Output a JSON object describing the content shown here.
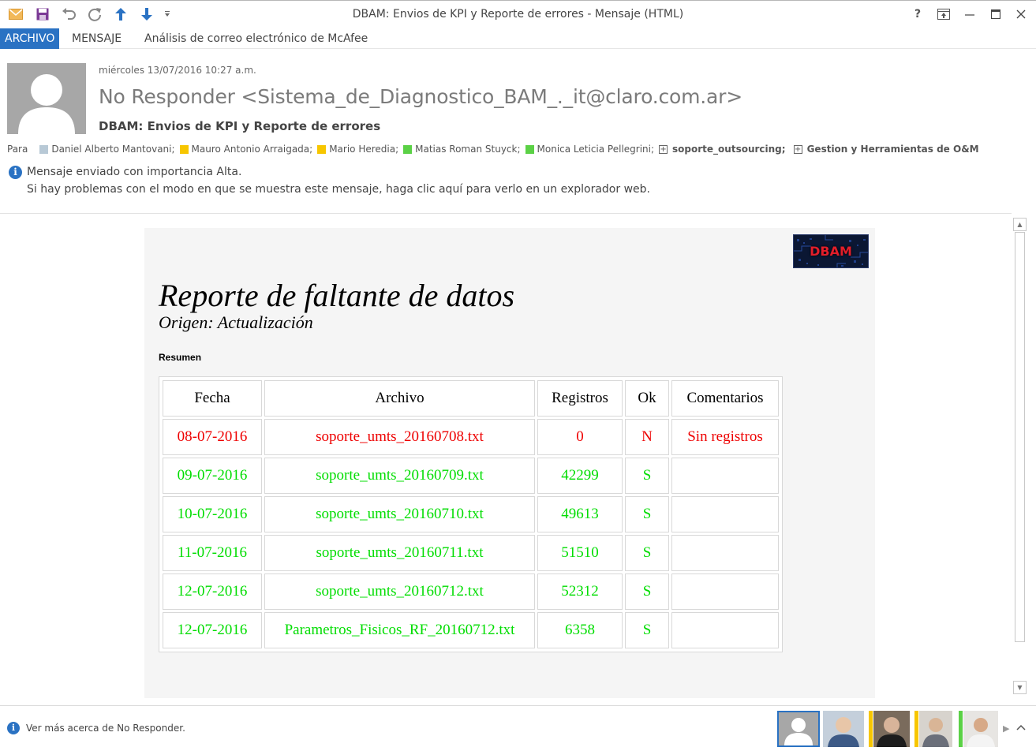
{
  "window": {
    "title": "DBAM: Envios de KPI y Reporte de errores - Mensaje (HTML)",
    "help": "?",
    "colors": {
      "accent": "#2a72c3",
      "purple": "#7b3a96"
    }
  },
  "ribbon": {
    "tabs": [
      {
        "label": "ARCHIVO",
        "active": true
      },
      {
        "label": "MENSAJE",
        "active": false
      },
      {
        "label": "Análisis de correo electrónico de McAfee",
        "active": false
      }
    ]
  },
  "header": {
    "date": "miércoles 13/07/2016 10:27 a.m.",
    "sender": "No Responder <Sistema_de_Diagnostico_BAM_._it@claro.com.ar>",
    "subject": "DBAM: Envios de KPI y Reporte de errores",
    "to_label": "Para",
    "recipients": [
      {
        "name": "Daniel Alberto Mantovani;",
        "color": "#b8c9d6"
      },
      {
        "name": "Mauro Antonio Arraigada;",
        "color": "#f7c600"
      },
      {
        "name": "Mario Heredia;",
        "color": "#f7c600"
      },
      {
        "name": "Matias Roman Stuyck;",
        "color": "#5bd146"
      },
      {
        "name": "Monica Leticia Pellegrini;",
        "color": "#5bd146"
      }
    ],
    "groups": [
      {
        "name": "soporte_outsourcing;"
      },
      {
        "name": "Gestion y Herramientas de O&M"
      }
    ],
    "info_line1": "Mensaje enviado con importancia Alta.",
    "info_line2": "Si hay problemas con el modo en que se muestra este mensaje, haga clic aquí para verlo en un explorador web."
  },
  "message": {
    "logo_text": "DBAM",
    "title": "Reporte de faltante de datos",
    "subtitle": "Origen: Actualización",
    "summary_label": "Resumen",
    "table": {
      "headers": [
        "Fecha",
        "Archivo",
        "Registros",
        "Ok",
        "Comentarios"
      ],
      "rows": [
        {
          "fecha": "08-07-2016",
          "archivo": "soporte_umts_20160708.txt",
          "registros": "0",
          "ok": "N",
          "comentarios": "Sin registros",
          "status": "red"
        },
        {
          "fecha": "09-07-2016",
          "archivo": "soporte_umts_20160709.txt",
          "registros": "42299",
          "ok": "S",
          "comentarios": "",
          "status": "green"
        },
        {
          "fecha": "10-07-2016",
          "archivo": "soporte_umts_20160710.txt",
          "registros": "49613",
          "ok": "S",
          "comentarios": "",
          "status": "green"
        },
        {
          "fecha": "11-07-2016",
          "archivo": "soporte_umts_20160711.txt",
          "registros": "51510",
          "ok": "S",
          "comentarios": "",
          "status": "green"
        },
        {
          "fecha": "12-07-2016",
          "archivo": "soporte_umts_20160712.txt",
          "registros": "52312",
          "ok": "S",
          "comentarios": "",
          "status": "green"
        },
        {
          "fecha": "12-07-2016",
          "archivo": "Parametros_Fisicos_RF_20160712.txt",
          "registros": "6358",
          "ok": "S",
          "comentarios": "",
          "status": "green"
        }
      ]
    }
  },
  "status_bar": {
    "text": "Ver más acerca de No Responder."
  }
}
